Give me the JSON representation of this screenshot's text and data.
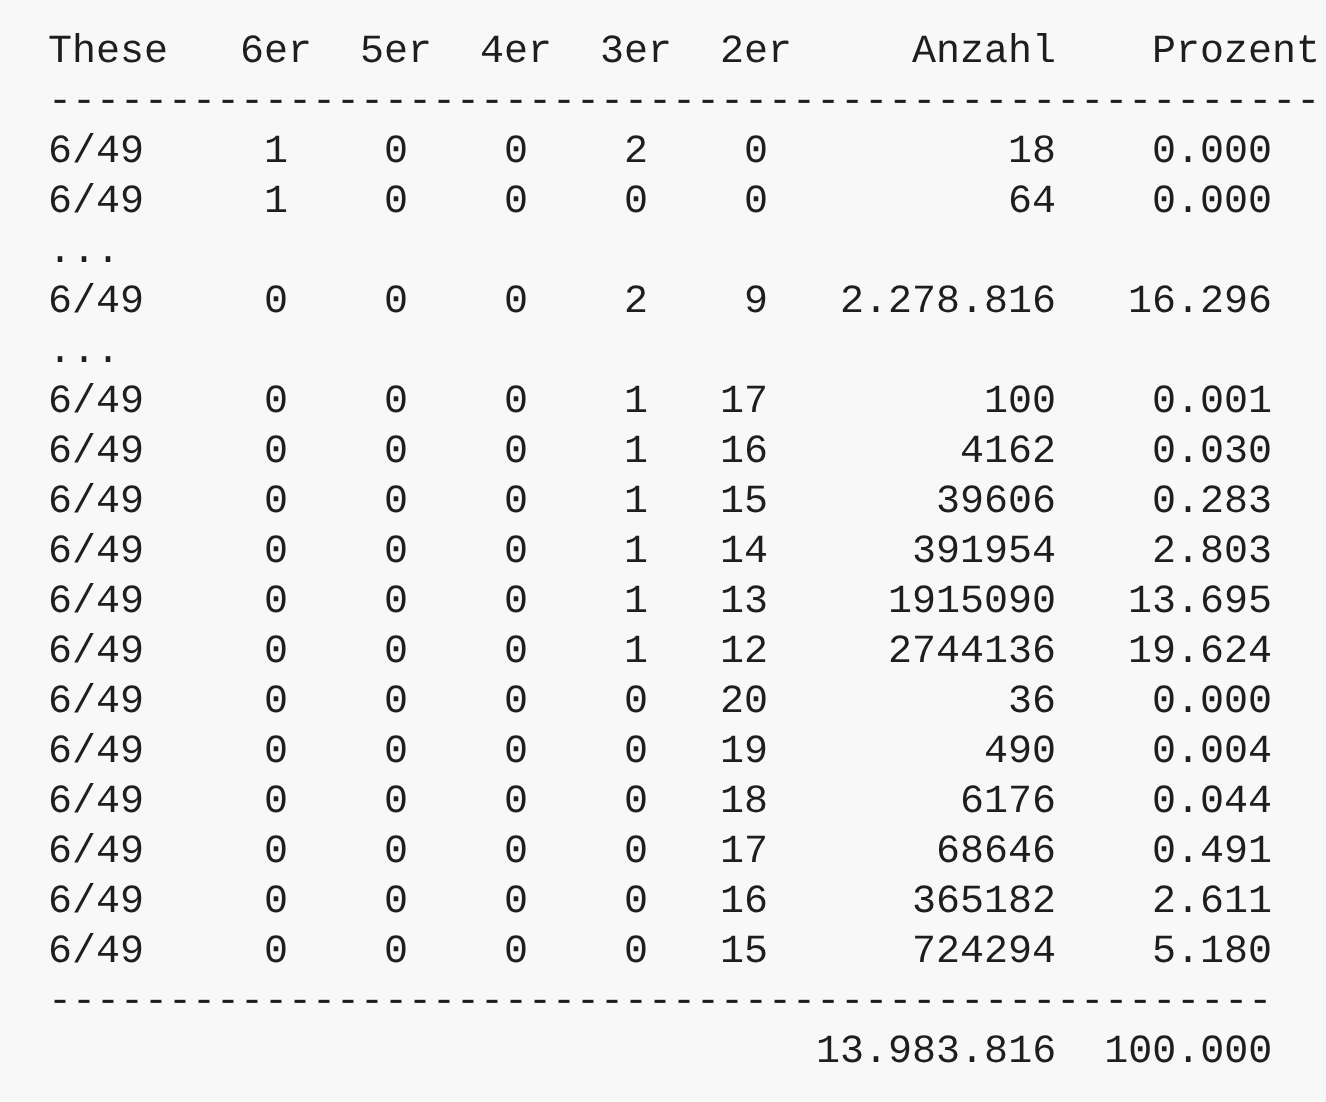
{
  "lines": [
    {
      "kind": "header",
      "cells": [
        "These",
        "6er",
        "5er",
        "4er",
        "3er",
        "2er",
        "Anzahl",
        "Prozent"
      ]
    },
    {
      "kind": "rule",
      "text": "-----------------------------------------------------"
    },
    {
      "kind": "row",
      "cells": [
        "6/49",
        "1",
        "0",
        "0",
        "2",
        "0",
        "18",
        "0.000"
      ]
    },
    {
      "kind": "row",
      "cells": [
        "6/49",
        "1",
        "0",
        "0",
        "0",
        "0",
        "64",
        "0.000"
      ]
    },
    {
      "kind": "ellipsis",
      "text": "..."
    },
    {
      "kind": "row",
      "cells": [
        "6/49",
        "0",
        "0",
        "0",
        "2",
        "9",
        "2.278.816",
        "16.296"
      ]
    },
    {
      "kind": "ellipsis",
      "text": "..."
    },
    {
      "kind": "row",
      "cells": [
        "6/49",
        "0",
        "0",
        "0",
        "1",
        "17",
        "100",
        "0.001"
      ]
    },
    {
      "kind": "row",
      "cells": [
        "6/49",
        "0",
        "0",
        "0",
        "1",
        "16",
        "4162",
        "0.030"
      ]
    },
    {
      "kind": "row",
      "cells": [
        "6/49",
        "0",
        "0",
        "0",
        "1",
        "15",
        "39606",
        "0.283"
      ]
    },
    {
      "kind": "row",
      "cells": [
        "6/49",
        "0",
        "0",
        "0",
        "1",
        "14",
        "391954",
        "2.803"
      ]
    },
    {
      "kind": "row",
      "cells": [
        "6/49",
        "0",
        "0",
        "0",
        "1",
        "13",
        "1915090",
        "13.695"
      ]
    },
    {
      "kind": "row",
      "cells": [
        "6/49",
        "0",
        "0",
        "0",
        "1",
        "12",
        "2744136",
        "19.624"
      ]
    },
    {
      "kind": "row",
      "cells": [
        "6/49",
        "0",
        "0",
        "0",
        "0",
        "20",
        "36",
        "0.000"
      ]
    },
    {
      "kind": "row",
      "cells": [
        "6/49",
        "0",
        "0",
        "0",
        "0",
        "19",
        "490",
        "0.004"
      ]
    },
    {
      "kind": "row",
      "cells": [
        "6/49",
        "0",
        "0",
        "0",
        "0",
        "18",
        "6176",
        "0.044"
      ]
    },
    {
      "kind": "row",
      "cells": [
        "6/49",
        "0",
        "0",
        "0",
        "0",
        "17",
        "68646",
        "0.491"
      ]
    },
    {
      "kind": "row",
      "cells": [
        "6/49",
        "0",
        "0",
        "0",
        "0",
        "16",
        "365182",
        "2.611"
      ]
    },
    {
      "kind": "row",
      "cells": [
        "6/49",
        "0",
        "0",
        "0",
        "0",
        "15",
        "724294",
        "5.180"
      ]
    },
    {
      "kind": "rule",
      "text": "---------------------------------------------------"
    },
    {
      "kind": "total",
      "cells": [
        "13.983.816",
        "100.000"
      ]
    }
  ]
}
